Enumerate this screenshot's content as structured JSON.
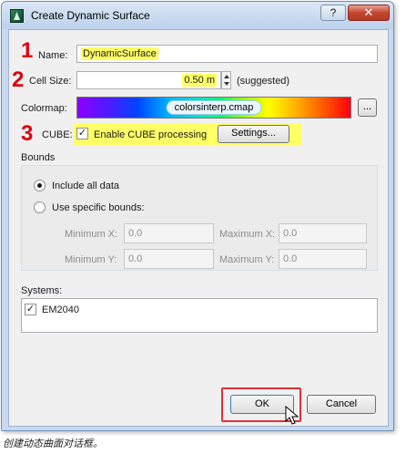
{
  "window": {
    "title": "Create Dynamic Surface",
    "help_label": "?",
    "close_label": "✕"
  },
  "annotations": {
    "n1": "1",
    "n2": "2",
    "n3": "3"
  },
  "form": {
    "name_label": "Name:",
    "name_value": "DynamicSurface",
    "cellsize_label": "Cell Size:",
    "cellsize_value": "0.50 m",
    "cellsize_note": "(suggested)",
    "colormap_label": "Colormap:",
    "colormap_value": "colorsinterp.cmap",
    "browse_label": "...",
    "cube_label": "CUBE:",
    "cube_checkbox_label": "Enable CUBE processing",
    "cube_checked": true,
    "settings_label": "Settings..."
  },
  "bounds": {
    "section_label": "Bounds",
    "include_all_label": "Include all data",
    "specific_label": "Use specific bounds:",
    "min_x_label": "Minimum X:",
    "min_x_value": "0.0",
    "max_x_label": "Maximum X:",
    "max_x_value": "0.0",
    "min_y_label": "Minimum Y:",
    "min_y_value": "0.0",
    "max_y_label": "Maximum Y:",
    "max_y_value": "0.0",
    "selected": "include_all"
  },
  "systems": {
    "section_label": "Systems:",
    "items": [
      {
        "label": "EM2040",
        "checked": true
      }
    ]
  },
  "buttons": {
    "ok_label": "OK",
    "cancel_label": "Cancel"
  },
  "caption": "创建动态曲面对话框。",
  "colors": {
    "annotation_red": "#e0000c",
    "highlight_yellow": "#ffff66"
  },
  "check_mark": "✓"
}
